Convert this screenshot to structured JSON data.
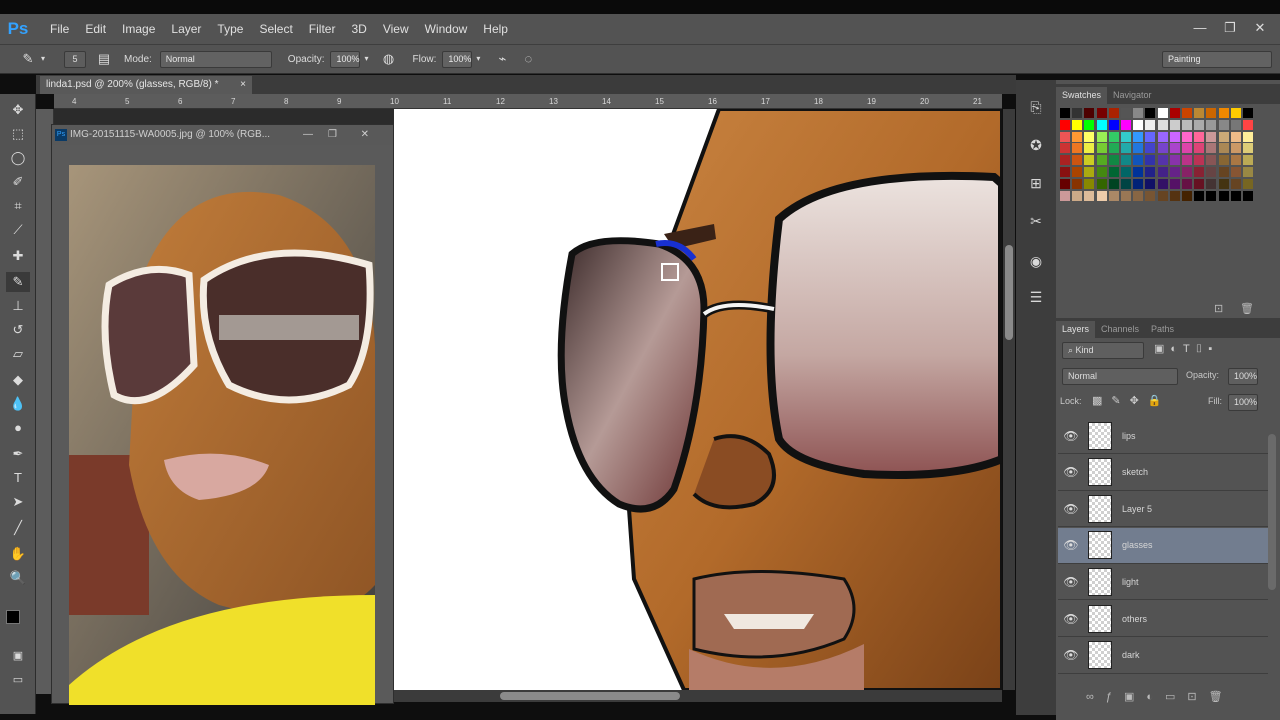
{
  "app": {
    "logo": "Ps"
  },
  "menu": [
    "File",
    "Edit",
    "Image",
    "Layer",
    "Type",
    "Select",
    "Filter",
    "3D",
    "View",
    "Window",
    "Help"
  ],
  "options": {
    "brush_size": "5",
    "mode_label": "Mode:",
    "mode_value": "Normal",
    "opacity_label": "Opacity:",
    "opacity_value": "100%",
    "flow_label": "Flow:",
    "flow_value": "100%",
    "workspace": "Painting"
  },
  "document": {
    "tab_title": "linda1.psd @ 200% (glasses, RGB/8) *",
    "close": "×"
  },
  "float_window": {
    "title": "IMG-20151115-WA0005.jpg @ 100% (RGB..."
  },
  "rulers": {
    "h_ticks": [
      "4",
      "5",
      "6",
      "7",
      "8",
      "9",
      "10",
      "11",
      "12",
      "13",
      "14",
      "15",
      "16",
      "17",
      "18",
      "19",
      "20",
      "21"
    ]
  },
  "panels": {
    "swatches_tab": "Swatches",
    "navigator_tab": "Navigator",
    "layers_tab": "Layers",
    "channels_tab": "Channels",
    "paths_tab": "Paths",
    "kind_label": "Kind",
    "blend_mode": "Normal",
    "opacity_label": "Opacity:",
    "opacity_value": "100%",
    "lock_label": "Lock:",
    "fill_label": "Fill:",
    "fill_value": "100%"
  },
  "layers": [
    {
      "name": "lips",
      "selected": false
    },
    {
      "name": "sketch",
      "selected": false
    },
    {
      "name": "Layer 5",
      "selected": false
    },
    {
      "name": "glasses",
      "selected": true
    },
    {
      "name": "light",
      "selected": false
    },
    {
      "name": "others",
      "selected": false
    },
    {
      "name": "dark",
      "selected": false
    }
  ],
  "colors": {
    "accent": "#33a2ff",
    "selected_layer": "#727d8f",
    "panel": "#535353"
  }
}
